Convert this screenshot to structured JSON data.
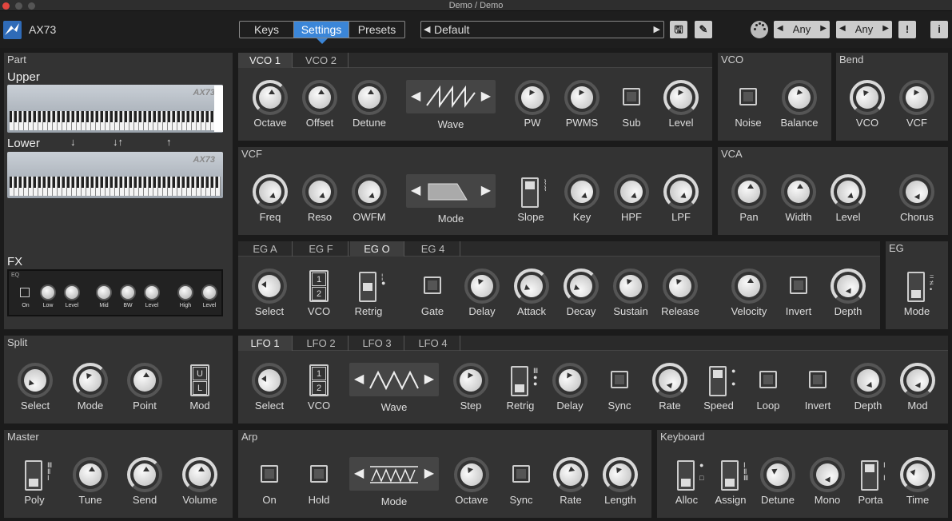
{
  "window_title": "Demo / Demo",
  "app_name": "AX73",
  "tabs": [
    "Keys",
    "Settings",
    "Presets"
  ],
  "active_tab": "Settings",
  "preset": {
    "value": "Default",
    "prev": "◀",
    "next": "▶"
  },
  "selectors": [
    {
      "value": "Any",
      "prev": "◀",
      "next": "▶"
    },
    {
      "value": "Any",
      "prev": "◀",
      "next": "▶"
    }
  ],
  "toolbar_buttons": {
    "save": "🖫",
    "edit": "✎",
    "alert": "!",
    "info": "i"
  },
  "part": {
    "title": "Part",
    "upper": "Upper",
    "lower": "Lower",
    "fx": "FX",
    "keyboard_brand": "AX73",
    "arrows": [
      "↓",
      "↓↑",
      "↑"
    ],
    "eq": {
      "label": "EQ",
      "items": [
        "On",
        "Low",
        "Level",
        "Mid",
        "BW",
        "Level",
        "High",
        "Level"
      ]
    }
  },
  "vco_tabs": [
    "VCO 1",
    "VCO 2"
  ],
  "vco_controls": [
    "Octave",
    "Offset",
    "Detune",
    "Wave",
    "PW",
    "PWMS",
    "Sub",
    "Level"
  ],
  "vco2": {
    "title": "VCO",
    "controls": [
      "Noise",
      "Balance"
    ]
  },
  "bend": {
    "title": "Bend",
    "controls": [
      "VCO",
      "VCF"
    ]
  },
  "vcf": {
    "title": "VCF",
    "controls": [
      "Freq",
      "Reso",
      "OWFM",
      "Mode",
      "Slope",
      "Key",
      "HPF",
      "LPF"
    ]
  },
  "vca": {
    "title": "VCA",
    "controls": [
      "Pan",
      "Width",
      "Level",
      "Chorus"
    ]
  },
  "eg_tabs": [
    "EG A",
    "EG F",
    "EG O",
    "EG 4"
  ],
  "eg_active": "EG O",
  "eg_controls": [
    "Select",
    "VCO",
    "Retrig",
    "Gate",
    "Delay",
    "Attack",
    "Decay",
    "Sustain",
    "Release",
    "Velocity",
    "Invert",
    "Depth"
  ],
  "eg_mode": {
    "title": "EG",
    "controls": [
      "Mode"
    ]
  },
  "split": {
    "title": "Split",
    "controls": [
      "Select",
      "Mode",
      "Point",
      "Mod"
    ]
  },
  "lfo_tabs": [
    "LFO 1",
    "LFO 2",
    "LFO 3",
    "LFO 4"
  ],
  "lfo_active": "LFO 1",
  "lfo_controls": [
    "Select",
    "VCO",
    "Wave",
    "Step",
    "Retrig",
    "Delay",
    "Sync",
    "Rate",
    "Speed",
    "Loop",
    "Invert",
    "Depth",
    "Mod"
  ],
  "master": {
    "title": "Master",
    "controls": [
      "Poly",
      "Tune",
      "Send",
      "Volume"
    ]
  },
  "arp": {
    "title": "Arp",
    "controls": [
      "On",
      "Hold",
      "Mode",
      "Octave",
      "Sync",
      "Rate",
      "Length"
    ]
  },
  "keyboard": {
    "title": "Keyboard",
    "controls": [
      "Alloc",
      "Assign",
      "Detune",
      "Mono",
      "Porta",
      "Time"
    ]
  },
  "pill_values": [
    "1",
    "2"
  ],
  "split_mod_values": [
    "U",
    "L"
  ],
  "colors": {
    "accent": "#3b86d8",
    "panel": "#333333",
    "background": "#1b1b1b"
  }
}
